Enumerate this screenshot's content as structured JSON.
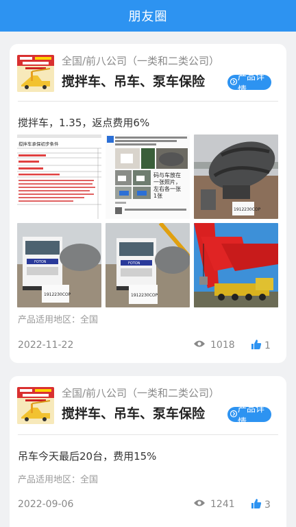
{
  "header": {
    "title": "朋友圈"
  },
  "posts": [
    {
      "category": "全国/前八公司（一类和二类公司）",
      "product": "搅拌车、吊车、泵车保险",
      "detail_label": "产品详情",
      "content": "搅拌车，1.35，返点费用6%",
      "region": "产品适用地区：全国",
      "date": "2022-11-22",
      "views": "1018",
      "likes": "1",
      "images": [
        {
          "kind": "document",
          "heading": "搅拌车承保初步条件"
        },
        {
          "kind": "chat-collage",
          "top_text": "验车视范例，验车码两天内有效，每日验车不超过…",
          "handwriting": "码与车放在一张照片，左右各一张1张"
        },
        {
          "kind": "mixer-rear",
          "plate_note": "1912230COP"
        },
        {
          "kind": "mixer-front",
          "plate_note": "1912230COP"
        },
        {
          "kind": "mixer-front",
          "plate_note": "1912230COP"
        },
        {
          "kind": "crane"
        }
      ]
    },
    {
      "category": "全国/前八公司（一类和二类公司）",
      "product": "搅拌车、吊车、泵车保险",
      "detail_label": "产品详情",
      "content": "吊车今天最后20台，费用15%",
      "region": "产品适用地区：全国",
      "date": "2022-09-06",
      "views": "1241",
      "likes": "3"
    }
  ],
  "colors": {
    "accent": "#2d93f1",
    "background": "#f0f1f3",
    "like_icon": "#2d93f1",
    "view_icon": "#888888"
  },
  "icons": [
    "eye-icon",
    "thumbs-up-icon",
    "chevron-right-icon"
  ]
}
